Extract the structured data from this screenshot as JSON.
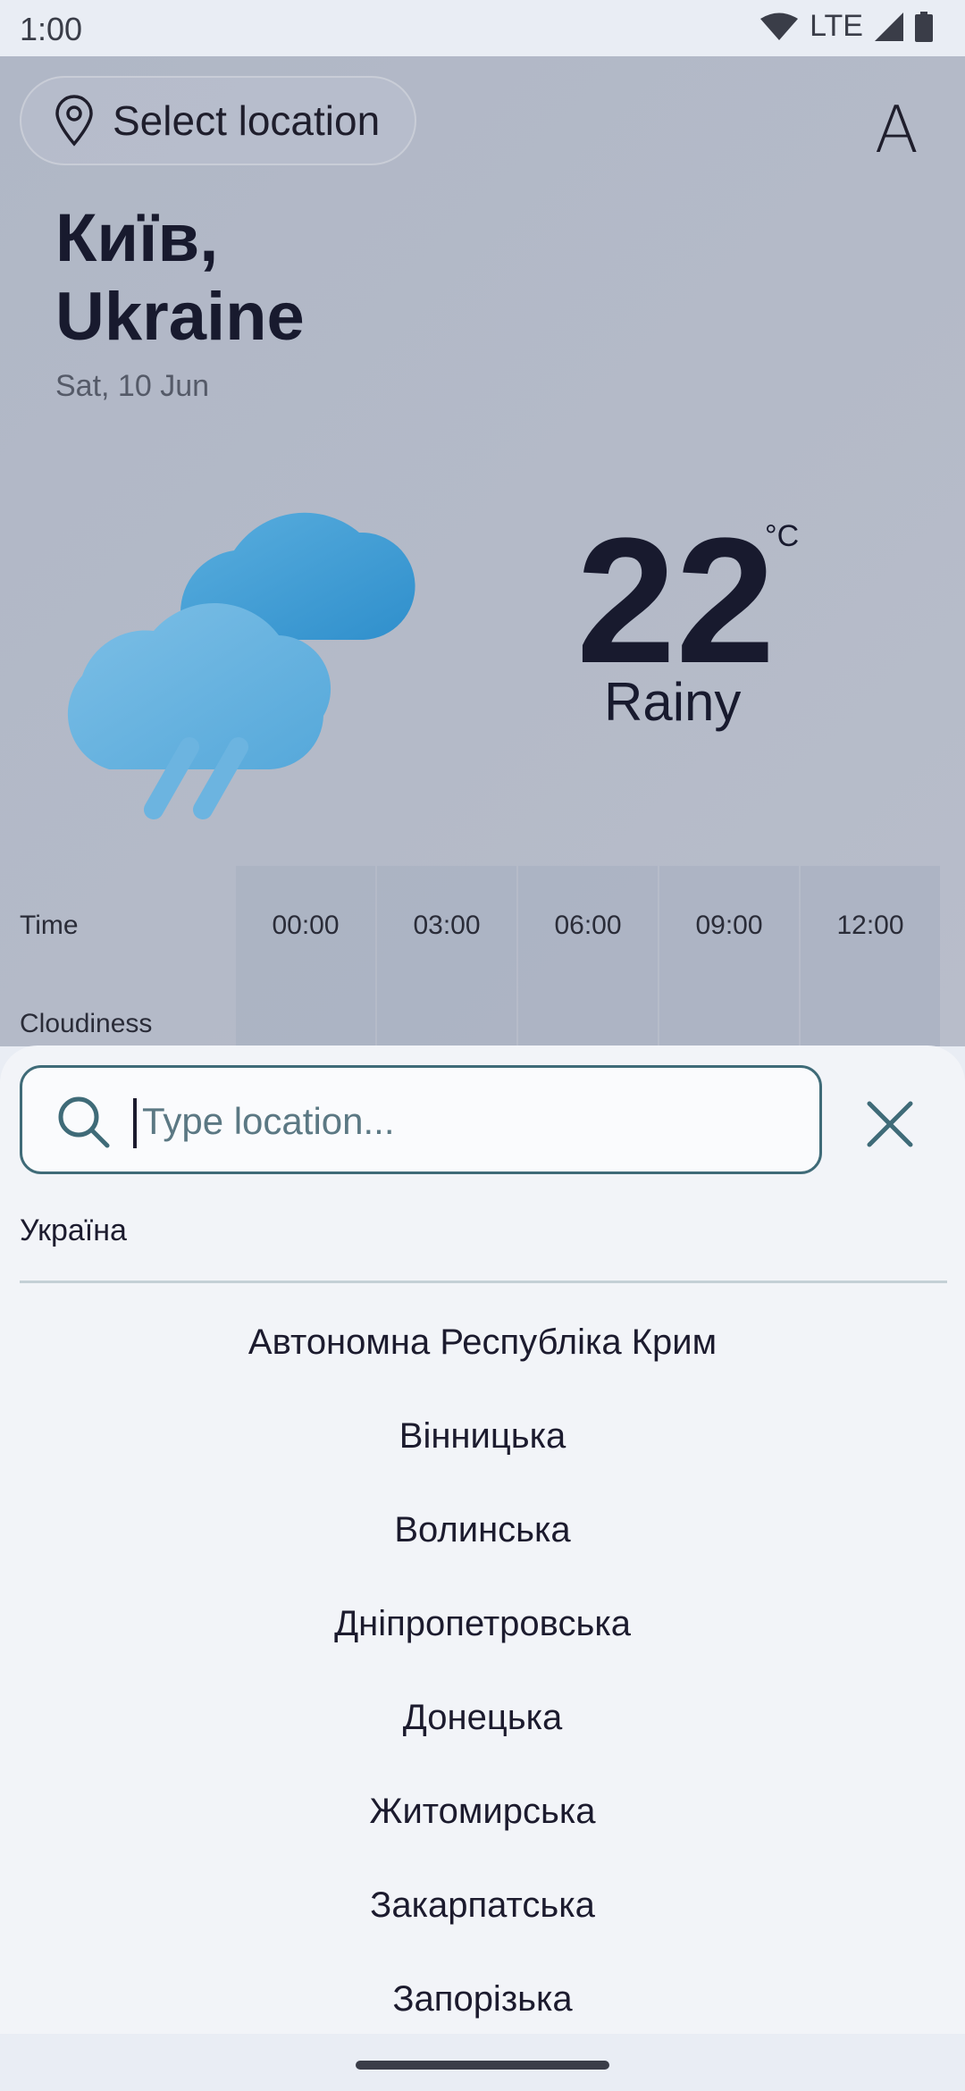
{
  "status_bar": {
    "time": "1:00",
    "network": "LTE"
  },
  "header": {
    "select_location_label": "Select location",
    "font_button_label": "A"
  },
  "weather": {
    "city_line1": "Київ,",
    "city_line2": "Ukraine",
    "date": "Sat, 10 Jun",
    "temperature": "22",
    "unit": "°C",
    "condition": "Rainy",
    "icon": "rain-cloud-icon"
  },
  "forecast": {
    "row_time_label": "Time",
    "row_cloud_label": "Cloudiness",
    "times": [
      "00:00",
      "03:00",
      "06:00",
      "09:00",
      "12:00"
    ]
  },
  "search": {
    "placeholder": "Type location...",
    "value": "",
    "country": "Україна",
    "regions": [
      "Автономна Республіка Крим",
      "Вінницька",
      "Волинська",
      "Дніпропетровська",
      "Донецька",
      "Житомирська",
      "Закарпатська",
      "Запорізька"
    ]
  },
  "colors": {
    "accent": "#3f6b78",
    "text": "#1c1b2e",
    "sheet_bg": "#f2f4f8"
  }
}
